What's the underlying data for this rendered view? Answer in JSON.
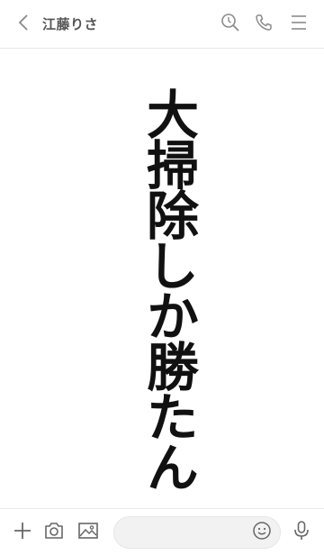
{
  "header": {
    "title": "江藤りさ",
    "back_icon": "chevron-left-icon",
    "search_icon": "search-icon",
    "call_icon": "phone-icon",
    "menu_icon": "menu-icon"
  },
  "main": {
    "message_text": "大掃除しか勝たん"
  },
  "footer": {
    "plus_icon": "plus-icon",
    "camera_icon": "camera-icon",
    "image_icon": "image-icon",
    "input_placeholder": "",
    "emoji_icon": "emoji-icon",
    "mic_icon": "microphone-icon"
  },
  "colors": {
    "icon": "#8a8a8a",
    "title": "#555555",
    "text": "#111111",
    "divider": "#e9e9e9",
    "input_bg": "#f2f2f2"
  }
}
